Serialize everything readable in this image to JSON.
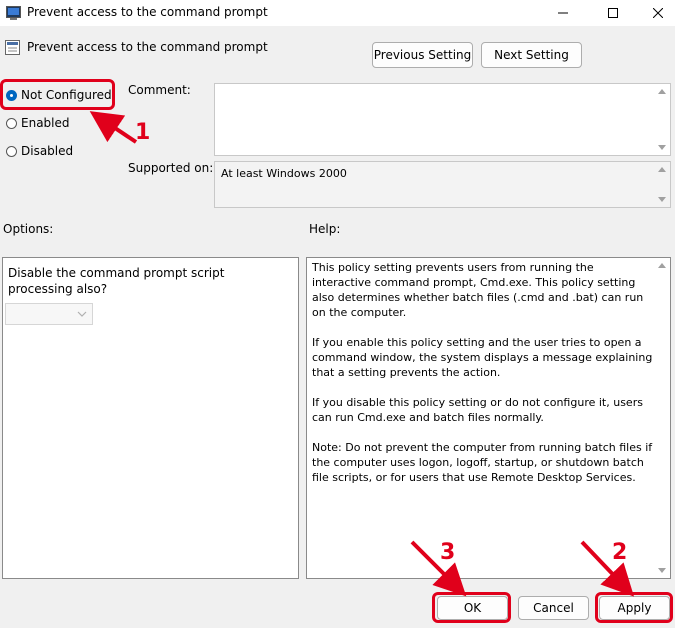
{
  "window": {
    "title": "Prevent access to the command prompt",
    "minimize_icon": "minimize-icon",
    "maximize_icon": "maximize-icon",
    "close_icon": "close-icon"
  },
  "header": {
    "policy_name": "Prevent access to the command prompt",
    "prev_button": "Previous Setting",
    "next_button": "Next Setting"
  },
  "state": {
    "options": [
      "Not Configured",
      "Enabled",
      "Disabled"
    ],
    "selected": "Not Configured"
  },
  "comment": {
    "label": "Comment:",
    "value": ""
  },
  "supported": {
    "label": "Supported on:",
    "value": "At least Windows 2000"
  },
  "options_panel": {
    "label": "Options:",
    "text": "Disable the command prompt script processing also?",
    "dropdown_value": ""
  },
  "help_panel": {
    "label": "Help:",
    "paragraphs": [
      "This policy setting prevents users from running the interactive command prompt, Cmd.exe.  This policy setting also determines whether batch files (.cmd and .bat) can run on the computer.",
      "If you enable this policy setting and the user tries to open a command window, the system displays a message explaining that a setting prevents the action.",
      "If you disable this policy setting or do not configure it, users can run Cmd.exe and batch files normally.",
      "Note: Do not prevent the computer from running batch files if the computer uses logon, logoff, startup, or shutdown batch file scripts, or for users that use Remote Desktop Services."
    ]
  },
  "footer": {
    "ok": "OK",
    "cancel": "Cancel",
    "apply": "Apply"
  },
  "annotations": {
    "marker_1": "1",
    "marker_2": "2",
    "marker_3": "3",
    "color": "#e0001b"
  }
}
